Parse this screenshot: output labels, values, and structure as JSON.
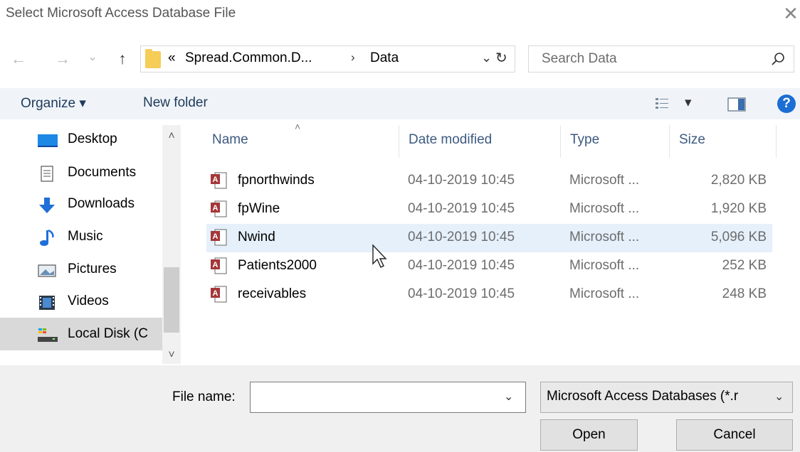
{
  "window": {
    "title": "Select Microsoft Access Database File",
    "close_glyph": "✕"
  },
  "nav": {
    "back_glyph": "←",
    "forward_glyph": "→",
    "recent_glyph": "⌄",
    "up_glyph": "↑",
    "crumb_overflow": "«",
    "crumbs": [
      "Spread.Common.D...",
      "Data"
    ],
    "crumb_separator": "›",
    "dropdown_glyph": "⌄",
    "refresh_glyph": "↻"
  },
  "search": {
    "placeholder": "Search Data"
  },
  "toolbar": {
    "organize": "Organize ▾",
    "new_folder": "New folder",
    "view_dd": "▾",
    "help": "?"
  },
  "sidebar": {
    "items": [
      {
        "label": "Desktop",
        "icon": "desktop-icon"
      },
      {
        "label": "Documents",
        "icon": "documents-icon"
      },
      {
        "label": "Downloads",
        "icon": "downloads-icon"
      },
      {
        "label": "Music",
        "icon": "music-icon"
      },
      {
        "label": "Pictures",
        "icon": "pictures-icon"
      },
      {
        "label": "Videos",
        "icon": "videos-icon"
      },
      {
        "label": "Local Disk (C",
        "icon": "local-disk-icon"
      }
    ],
    "scroll_up": "˄",
    "scroll_down": "˅"
  },
  "files": {
    "columns": [
      "Name",
      "Date modified",
      "Type",
      "Size"
    ],
    "sort_glyph": "˄",
    "rows": [
      {
        "name": "fpnorthwinds",
        "date": "04-10-2019 10:45",
        "type": "Microsoft ...",
        "size": "2,820 KB"
      },
      {
        "name": "fpWine",
        "date": "04-10-2019 10:45",
        "type": "Microsoft ...",
        "size": "1,920 KB"
      },
      {
        "name": "Nwind",
        "date": "04-10-2019 10:45",
        "type": "Microsoft ...",
        "size": "5,096 KB"
      },
      {
        "name": "Patients2000",
        "date": "04-10-2019 10:45",
        "type": "Microsoft ...",
        "size": "252 KB"
      },
      {
        "name": "receivables",
        "date": "04-10-2019 10:45",
        "type": "Microsoft ...",
        "size": "248 KB"
      }
    ],
    "highlight_color": "#e5f0fb"
  },
  "footer": {
    "file_name_label": "File name:",
    "file_name_value": "",
    "filter_value": "Microsoft Access Databases (*.r",
    "dropdown_glyph": "⌄",
    "open_label": "Open",
    "cancel_label": "Cancel"
  },
  "colors": {
    "accent": "#1b6ed3",
    "folder": "#f5cd57",
    "selection": "#d9d9d9"
  }
}
